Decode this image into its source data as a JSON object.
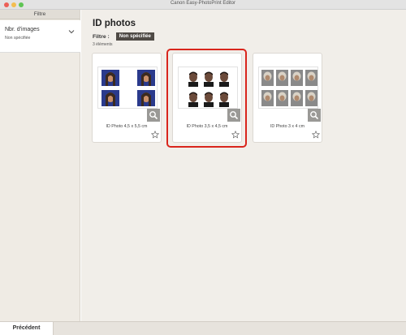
{
  "window": {
    "title": "Canon Easy-PhotoPrint Editor"
  },
  "sidebar": {
    "header": "Filtre",
    "filter": {
      "title": "Nbr. d'images",
      "value": "Non spécifiée"
    }
  },
  "main": {
    "title": "ID photos",
    "filter_label": "Filtre :",
    "filter_chip": "Non spécifiée",
    "count": "3 éléments",
    "cards": [
      {
        "label": "ID Photo 4,5 x 5,5 cm",
        "selected": false
      },
      {
        "label": "ID Photo 3,5 x 4,5 cm",
        "selected": true
      },
      {
        "label": "ID Photo 3 x 4 cm",
        "selected": false
      }
    ]
  },
  "bottom": {
    "prev_label": "Précédent"
  },
  "colors": {
    "selection": "#d9251c",
    "chip_bg": "#4f4a45",
    "zoom_bg": "#9a9996"
  }
}
